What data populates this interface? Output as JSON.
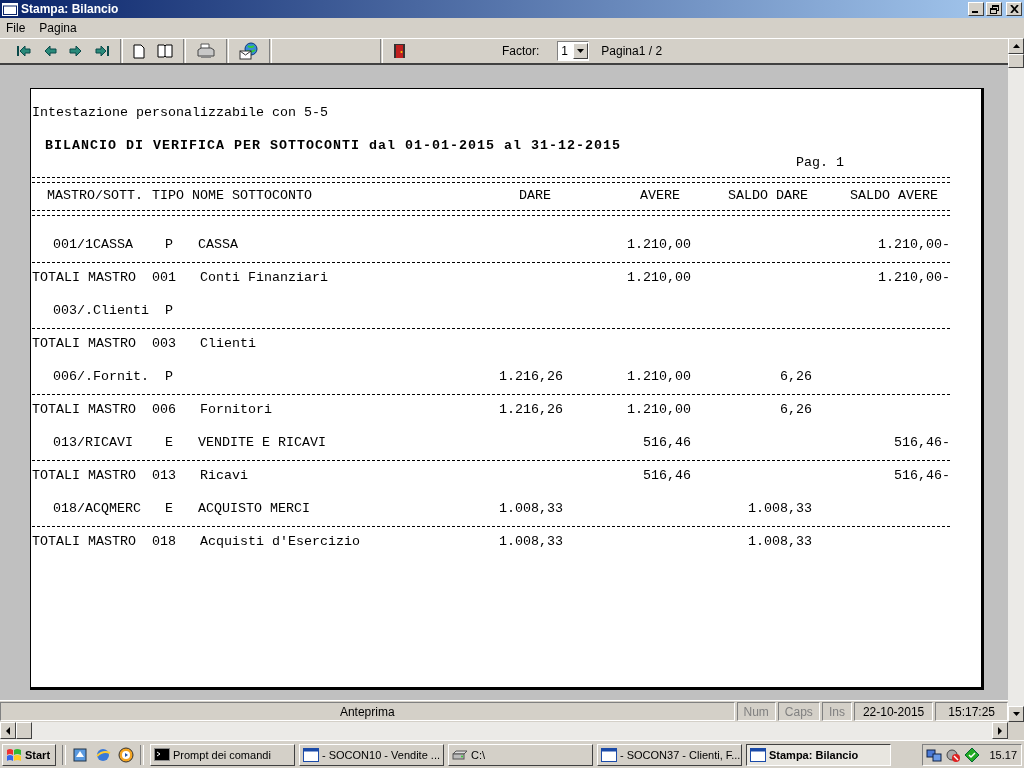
{
  "window": {
    "title": "Stampa: Bilancio"
  },
  "menu": [
    {
      "label": "File"
    },
    {
      "label": "Pagina"
    }
  ],
  "toolbar": {
    "factor_label": "Factor:",
    "factor_value": "1",
    "page_info": "Pagina1 / 2"
  },
  "report": {
    "header_note": "Intestazione personalizzabile con 5-5",
    "title": "BILANCIO DI VERIFICA PER SOTTOCONTI dal 01-01-2015 al 31-12-2015",
    "page_label": "Pag. 1",
    "columns": [
      "MASTRO/SOTT.",
      "TIPO",
      "NOME SOTTOCONTO",
      "DARE",
      "AVERE",
      "SALDO DARE",
      "SALDO AVERE"
    ],
    "rows": [
      {
        "kind": "account",
        "code": "001/1CASSA",
        "type": "P",
        "name": "CASSA",
        "avere": "1.210,00",
        "saldo_avere": "1.210,00-"
      },
      {
        "kind": "total",
        "label": "TOTALI MASTRO",
        "mastro": "001",
        "name": "Conti Finanziari",
        "avere": "1.210,00",
        "saldo_avere": "1.210,00-"
      },
      {
        "kind": "account",
        "code": "003/.Clienti",
        "type": "P"
      },
      {
        "kind": "total",
        "label": "TOTALI MASTRO",
        "mastro": "003",
        "name": "Clienti"
      },
      {
        "kind": "account",
        "code": "006/.Fornit.",
        "type": "P",
        "dare": "1.216,26",
        "avere": "1.210,00",
        "saldo_dare": "6,26"
      },
      {
        "kind": "total",
        "label": "TOTALI MASTRO",
        "mastro": "006",
        "name": "Fornitori",
        "dare": "1.216,26",
        "avere": "1.210,00",
        "saldo_dare": "6,26"
      },
      {
        "kind": "account",
        "code": "013/RICAVI",
        "type": "E",
        "name": "VENDITE E RICAVI",
        "avere": "516,46",
        "saldo_avere": "516,46-"
      },
      {
        "kind": "total",
        "label": "TOTALI MASTRO",
        "mastro": "013",
        "name": "Ricavi",
        "avere": "516,46",
        "saldo_avere": "516,46-"
      },
      {
        "kind": "account",
        "code": "018/ACQMERC",
        "type": "E",
        "name": "ACQUISTO MERCI",
        "dare": "1.008,33",
        "saldo_dare": "1.008,33"
      },
      {
        "kind": "total",
        "label": "TOTALI MASTRO",
        "mastro": "018",
        "name": "Acquisti d'Esercizio",
        "dare": "1.008,33",
        "saldo_dare": "1.008,33"
      }
    ]
  },
  "status_bar": {
    "text": "Anteprima",
    "indicators": [
      {
        "label": "Num",
        "on": false
      },
      {
        "label": "Caps",
        "on": false
      },
      {
        "label": "Ins",
        "on": false
      }
    ],
    "date": "22-10-2015",
    "time": "15:17:25"
  },
  "taskbar": {
    "start": "Start",
    "tasks": [
      {
        "label": "Prompt dei comandi",
        "kind": "console",
        "selected": false
      },
      {
        "label": "- SOCON10 - Vendite ...",
        "kind": "window",
        "selected": false
      },
      {
        "label": "C:\\",
        "kind": "drive",
        "selected": false
      },
      {
        "label": "- SOCON37 - Clienti, F...",
        "kind": "window",
        "selected": false
      },
      {
        "label": "Stampa: Bilancio",
        "kind": "window",
        "selected": true
      }
    ],
    "clock": "15.17"
  }
}
